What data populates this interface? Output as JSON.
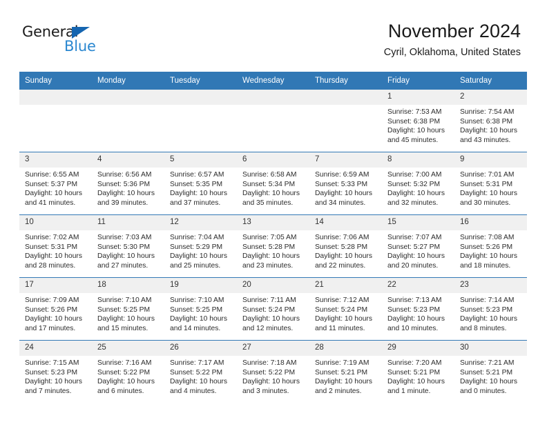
{
  "brand": {
    "name_part1": "General",
    "name_part2": "Blue",
    "accent_color": "#2a87d0",
    "triangle_color": "#1565b0"
  },
  "header": {
    "title": "November 2024",
    "location": "Cyril, Oklahoma, United States"
  },
  "calendar": {
    "header_bg": "#3178b5",
    "daynum_bg": "#f0f0f0",
    "weekday_headers": [
      "Sunday",
      "Monday",
      "Tuesday",
      "Wednesday",
      "Thursday",
      "Friday",
      "Saturday"
    ],
    "weeks": [
      [
        {
          "day": "",
          "empty": true
        },
        {
          "day": "",
          "empty": true
        },
        {
          "day": "",
          "empty": true
        },
        {
          "day": "",
          "empty": true
        },
        {
          "day": "",
          "empty": true
        },
        {
          "day": "1",
          "sunrise": "Sunrise: 7:53 AM",
          "sunset": "Sunset: 6:38 PM",
          "daylight_1": "Daylight: 10 hours",
          "daylight_2": "and 45 minutes."
        },
        {
          "day": "2",
          "sunrise": "Sunrise: 7:54 AM",
          "sunset": "Sunset: 6:38 PM",
          "daylight_1": "Daylight: 10 hours",
          "daylight_2": "and 43 minutes."
        }
      ],
      [
        {
          "day": "3",
          "sunrise": "Sunrise: 6:55 AM",
          "sunset": "Sunset: 5:37 PM",
          "daylight_1": "Daylight: 10 hours",
          "daylight_2": "and 41 minutes."
        },
        {
          "day": "4",
          "sunrise": "Sunrise: 6:56 AM",
          "sunset": "Sunset: 5:36 PM",
          "daylight_1": "Daylight: 10 hours",
          "daylight_2": "and 39 minutes."
        },
        {
          "day": "5",
          "sunrise": "Sunrise: 6:57 AM",
          "sunset": "Sunset: 5:35 PM",
          "daylight_1": "Daylight: 10 hours",
          "daylight_2": "and 37 minutes."
        },
        {
          "day": "6",
          "sunrise": "Sunrise: 6:58 AM",
          "sunset": "Sunset: 5:34 PM",
          "daylight_1": "Daylight: 10 hours",
          "daylight_2": "and 35 minutes."
        },
        {
          "day": "7",
          "sunrise": "Sunrise: 6:59 AM",
          "sunset": "Sunset: 5:33 PM",
          "daylight_1": "Daylight: 10 hours",
          "daylight_2": "and 34 minutes."
        },
        {
          "day": "8",
          "sunrise": "Sunrise: 7:00 AM",
          "sunset": "Sunset: 5:32 PM",
          "daylight_1": "Daylight: 10 hours",
          "daylight_2": "and 32 minutes."
        },
        {
          "day": "9",
          "sunrise": "Sunrise: 7:01 AM",
          "sunset": "Sunset: 5:31 PM",
          "daylight_1": "Daylight: 10 hours",
          "daylight_2": "and 30 minutes."
        }
      ],
      [
        {
          "day": "10",
          "sunrise": "Sunrise: 7:02 AM",
          "sunset": "Sunset: 5:31 PM",
          "daylight_1": "Daylight: 10 hours",
          "daylight_2": "and 28 minutes."
        },
        {
          "day": "11",
          "sunrise": "Sunrise: 7:03 AM",
          "sunset": "Sunset: 5:30 PM",
          "daylight_1": "Daylight: 10 hours",
          "daylight_2": "and 27 minutes."
        },
        {
          "day": "12",
          "sunrise": "Sunrise: 7:04 AM",
          "sunset": "Sunset: 5:29 PM",
          "daylight_1": "Daylight: 10 hours",
          "daylight_2": "and 25 minutes."
        },
        {
          "day": "13",
          "sunrise": "Sunrise: 7:05 AM",
          "sunset": "Sunset: 5:28 PM",
          "daylight_1": "Daylight: 10 hours",
          "daylight_2": "and 23 minutes."
        },
        {
          "day": "14",
          "sunrise": "Sunrise: 7:06 AM",
          "sunset": "Sunset: 5:28 PM",
          "daylight_1": "Daylight: 10 hours",
          "daylight_2": "and 22 minutes."
        },
        {
          "day": "15",
          "sunrise": "Sunrise: 7:07 AM",
          "sunset": "Sunset: 5:27 PM",
          "daylight_1": "Daylight: 10 hours",
          "daylight_2": "and 20 minutes."
        },
        {
          "day": "16",
          "sunrise": "Sunrise: 7:08 AM",
          "sunset": "Sunset: 5:26 PM",
          "daylight_1": "Daylight: 10 hours",
          "daylight_2": "and 18 minutes."
        }
      ],
      [
        {
          "day": "17",
          "sunrise": "Sunrise: 7:09 AM",
          "sunset": "Sunset: 5:26 PM",
          "daylight_1": "Daylight: 10 hours",
          "daylight_2": "and 17 minutes."
        },
        {
          "day": "18",
          "sunrise": "Sunrise: 7:10 AM",
          "sunset": "Sunset: 5:25 PM",
          "daylight_1": "Daylight: 10 hours",
          "daylight_2": "and 15 minutes."
        },
        {
          "day": "19",
          "sunrise": "Sunrise: 7:10 AM",
          "sunset": "Sunset: 5:25 PM",
          "daylight_1": "Daylight: 10 hours",
          "daylight_2": "and 14 minutes."
        },
        {
          "day": "20",
          "sunrise": "Sunrise: 7:11 AM",
          "sunset": "Sunset: 5:24 PM",
          "daylight_1": "Daylight: 10 hours",
          "daylight_2": "and 12 minutes."
        },
        {
          "day": "21",
          "sunrise": "Sunrise: 7:12 AM",
          "sunset": "Sunset: 5:24 PM",
          "daylight_1": "Daylight: 10 hours",
          "daylight_2": "and 11 minutes."
        },
        {
          "day": "22",
          "sunrise": "Sunrise: 7:13 AM",
          "sunset": "Sunset: 5:23 PM",
          "daylight_1": "Daylight: 10 hours",
          "daylight_2": "and 10 minutes."
        },
        {
          "day": "23",
          "sunrise": "Sunrise: 7:14 AM",
          "sunset": "Sunset: 5:23 PM",
          "daylight_1": "Daylight: 10 hours",
          "daylight_2": "and 8 minutes."
        }
      ],
      [
        {
          "day": "24",
          "sunrise": "Sunrise: 7:15 AM",
          "sunset": "Sunset: 5:23 PM",
          "daylight_1": "Daylight: 10 hours",
          "daylight_2": "and 7 minutes."
        },
        {
          "day": "25",
          "sunrise": "Sunrise: 7:16 AM",
          "sunset": "Sunset: 5:22 PM",
          "daylight_1": "Daylight: 10 hours",
          "daylight_2": "and 6 minutes."
        },
        {
          "day": "26",
          "sunrise": "Sunrise: 7:17 AM",
          "sunset": "Sunset: 5:22 PM",
          "daylight_1": "Daylight: 10 hours",
          "daylight_2": "and 4 minutes."
        },
        {
          "day": "27",
          "sunrise": "Sunrise: 7:18 AM",
          "sunset": "Sunset: 5:22 PM",
          "daylight_1": "Daylight: 10 hours",
          "daylight_2": "and 3 minutes."
        },
        {
          "day": "28",
          "sunrise": "Sunrise: 7:19 AM",
          "sunset": "Sunset: 5:21 PM",
          "daylight_1": "Daylight: 10 hours",
          "daylight_2": "and 2 minutes."
        },
        {
          "day": "29",
          "sunrise": "Sunrise: 7:20 AM",
          "sunset": "Sunset: 5:21 PM",
          "daylight_1": "Daylight: 10 hours",
          "daylight_2": "and 1 minute."
        },
        {
          "day": "30",
          "sunrise": "Sunrise: 7:21 AM",
          "sunset": "Sunset: 5:21 PM",
          "daylight_1": "Daylight: 10 hours",
          "daylight_2": "and 0 minutes."
        }
      ]
    ]
  }
}
